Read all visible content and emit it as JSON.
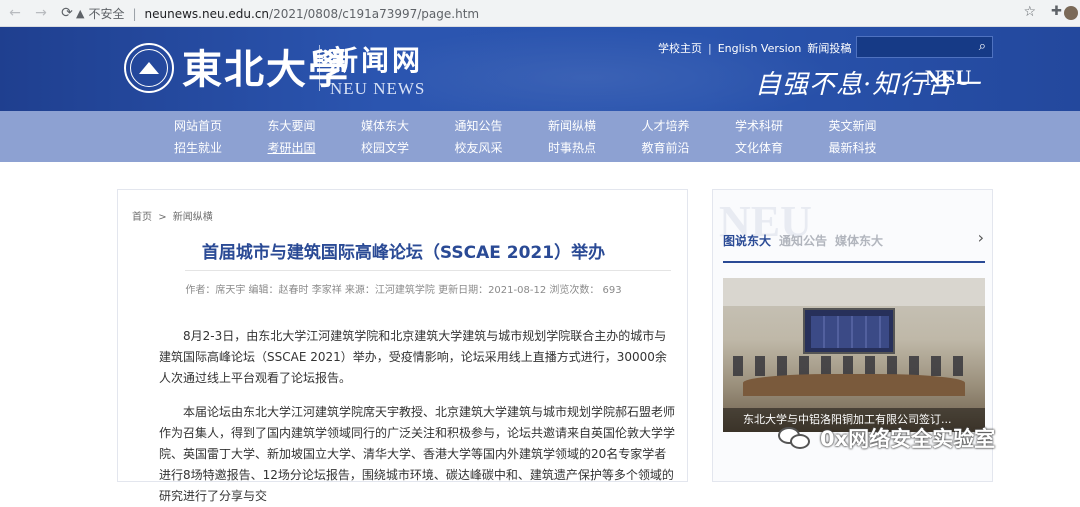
{
  "browser": {
    "security_label": "不安全",
    "separator": "|",
    "url_host": "neunews.neu.edu.cn",
    "url_path": "/2021/0808/c191a73997/page.htm"
  },
  "header": {
    "logo_calligraphy": "東北大學",
    "site_name": "新闻网",
    "site_name_en": "NEU NEWS",
    "top_links": [
      "学校主页",
      "English Version",
      "新闻投稿"
    ],
    "top_link_separator": "|",
    "motto": "自强不息·知行合一",
    "motto_mark": "NEU"
  },
  "nav": {
    "row1": [
      "网站首页",
      "东大要闻",
      "媒体东大",
      "通知公告",
      "新闻纵横",
      "人才培养",
      "学术科研",
      "英文新闻"
    ],
    "row2": [
      "招生就业",
      "考研出国",
      "校园文学",
      "校友风采",
      "时事热点",
      "教育前沿",
      "文化体育",
      "最新科技"
    ]
  },
  "article": {
    "breadcrumb_home": "首页",
    "breadcrumb_sep": ">",
    "breadcrumb_current": "新闻纵横",
    "title": "首届城市与建筑国际高峰论坛（SSCAE 2021）举办",
    "meta": "作者：席天宇   编辑：赵春时 李家祥   来源：江河建筑学院   更新日期：2021-08-12   浏览次数：  693",
    "paragraphs": [
      "8月2-3日，由东北大学江河建筑学院和北京建筑大学建筑与城市规划学院联合主办的城市与建筑国际高峰论坛（SSCAE 2021）举办，受疫情影响，论坛采用线上直播方式进行，30000余人次通过线上平台观看了论坛报告。",
      "本届论坛由东北大学江河建筑学院席天宇教授、北京建筑大学建筑与城市规划学院郝石盟老师作为召集人，得到了国内建筑学领域同行的广泛关注和积极参与，论坛共邀请来自英国伦敦大学学院、英国雷丁大学、新加坡国立大学、清华大学、香港大学等国内外建筑学领域的20名专家学者进行8场特邀报告、12场分论坛报告，围绕城市环境、碳达峰碳中和、建筑遗产保护等多个领域的研究进行了分享与交"
    ]
  },
  "sidebar": {
    "watermark": "NEU",
    "tabs": [
      "图说东大",
      "通知公告",
      "媒体东大"
    ],
    "arrow": "›",
    "caption": "东北大学与中铝洛阳铜加工有限公司签订..."
  },
  "overlay": {
    "wechat_text": "0x网络安全实验室"
  }
}
